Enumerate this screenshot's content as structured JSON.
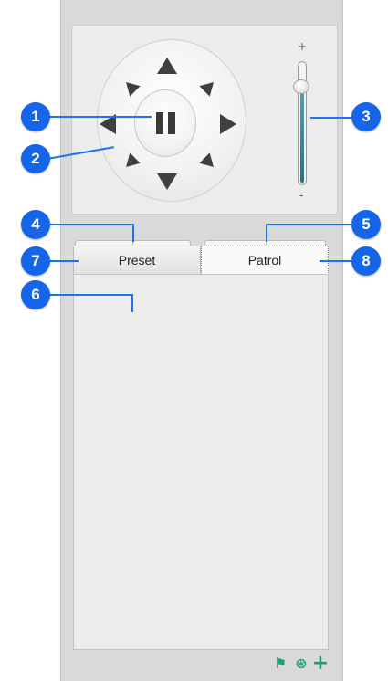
{
  "ptz": {
    "directions": [
      "up",
      "down",
      "left",
      "right",
      "up-left",
      "up-right",
      "down-left",
      "down-right"
    ],
    "center_action": "pause",
    "zoom_slider": {
      "plus_label": "+",
      "minus_label": "-",
      "level": 0.8
    }
  },
  "buttons": {
    "zoom_in_icon": "zoom-in-magnifier",
    "zoom_out_icon": "zoom-out-magnifier",
    "focus_near_icon": "focus-plus-bracket",
    "focus_far_icon": "focus-minus-bracket",
    "zoom_in_glyph": "⊕",
    "zoom_out_glyph": "⊖",
    "focus_near_glyph": "[+]",
    "focus_far_glyph": "[-]"
  },
  "mode_tabs": {
    "tab1_glyph": "✱",
    "tab2_glyph": "✱"
  },
  "list_tabs": {
    "preset_label": "Preset",
    "patrol_label": "Patrol"
  },
  "callouts": [
    "1",
    "2",
    "3",
    "4",
    "5",
    "6",
    "7",
    "8"
  ],
  "colors": {
    "callout": "#1565e8",
    "accent_icons": "#1aa07a",
    "slider_fill": "#2a6f8c"
  },
  "bottom_icons": [
    "route-icon",
    "camera-patrol-icon",
    "add-icon"
  ]
}
